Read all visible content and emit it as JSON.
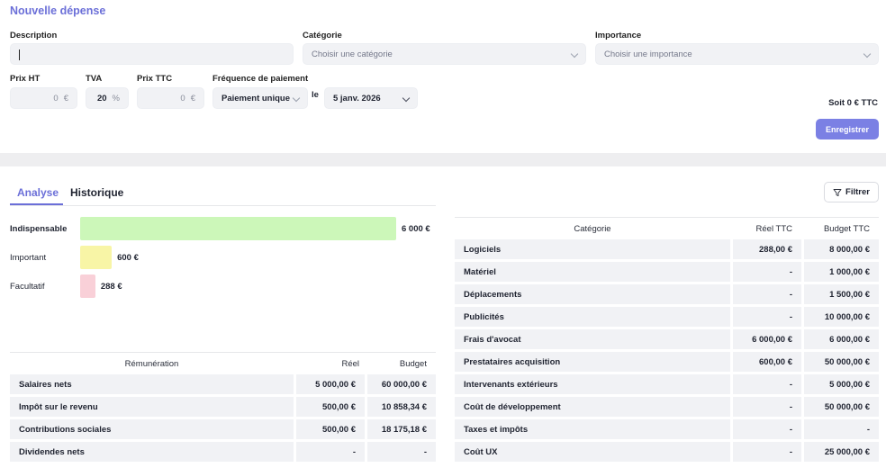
{
  "form": {
    "title": "Nouvelle dépense",
    "description_label": "Description",
    "description_value": "",
    "category_label": "Catégorie",
    "category_placeholder": "Choisir une catégorie",
    "importance_label": "Importance",
    "importance_placeholder": "Choisir une importance",
    "prix_ht_label": "Prix HT",
    "prix_ht_value": "0",
    "tva_label": "TVA",
    "tva_value": "20",
    "prix_ttc_label": "Prix TTC",
    "prix_ttc_value": "0",
    "currency_unit": "€",
    "percent_unit": "%",
    "frequency_label": "Fréquence de paiement",
    "frequency_value": "Paiement unique",
    "date_prefix": "le",
    "date_value": "5 janv. 2026",
    "total_text": "Soit 0 € TTC",
    "save_label": "Enregistrer"
  },
  "tabs": [
    {
      "label": "Analyse",
      "active": true
    },
    {
      "label": "Historique",
      "active": false
    }
  ],
  "filter_label": "Filtrer",
  "chart_data": {
    "type": "bar",
    "orientation": "horizontal",
    "categories": [
      "Indispensable",
      "Important",
      "Facultatif"
    ],
    "values": [
      6000,
      600,
      288
    ],
    "value_labels": [
      "6 000 €",
      "600 €",
      "288 €"
    ],
    "colors": [
      "#ccf7b9",
      "#f8f5a6",
      "#f9d0d8"
    ],
    "unit": "€"
  },
  "remuneration": {
    "headers": [
      "Rémunération",
      "Réel",
      "Budget"
    ],
    "rows": [
      [
        "Salaires nets",
        "5 000,00 €",
        "60 000,00 €"
      ],
      [
        "Impôt sur le revenu",
        "500,00 €",
        "10 858,34 €"
      ],
      [
        "Contributions sociales",
        "500,00 €",
        "18 175,18 €"
      ],
      [
        "Dividendes nets",
        "-",
        "-"
      ]
    ]
  },
  "categories_table": {
    "headers": [
      "Catégorie",
      "Réel TTC",
      "Budget TTC"
    ],
    "rows": [
      [
        "Logiciels",
        "288,00 €",
        "8 000,00 €"
      ],
      [
        "Matériel",
        "-",
        "1 000,00 €"
      ],
      [
        "Déplacements",
        "-",
        "1 500,00 €"
      ],
      [
        "Publicités",
        "-",
        "10 000,00 €"
      ],
      [
        "Frais d'avocat",
        "6 000,00 €",
        "6 000,00 €"
      ],
      [
        "Prestataires acquisition",
        "600,00 €",
        "50 000,00 €"
      ],
      [
        "Intervenants extérieurs",
        "-",
        "5 000,00 €"
      ],
      [
        "Coût de développement",
        "-",
        "50 000,00 €"
      ],
      [
        "Taxes et impôts",
        "-",
        "-"
      ],
      [
        "Coût UX",
        "-",
        "25 000,00 €"
      ]
    ]
  }
}
